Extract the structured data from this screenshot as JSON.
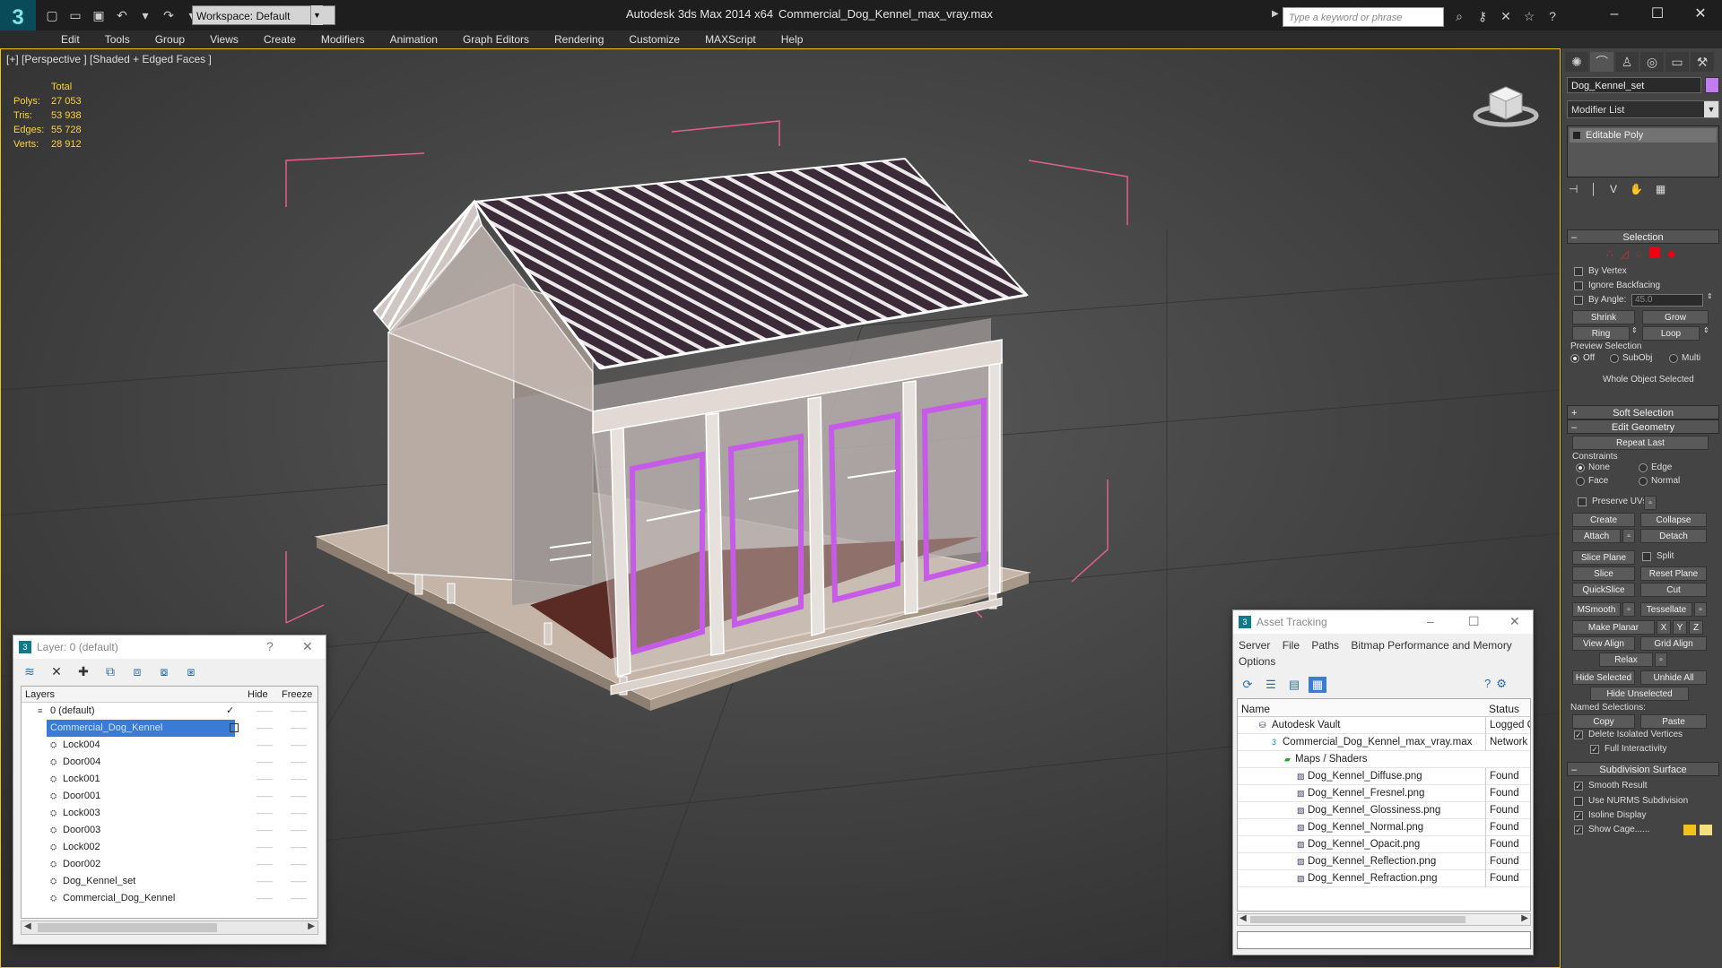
{
  "app": {
    "title": "Autodesk 3ds Max  2014 x64",
    "file": "Commercial_Dog_Kennel_max_vray.max",
    "workspace": "Workspace: Default",
    "search_placeholder": "Type a keyword or phrase"
  },
  "menu": [
    "Edit",
    "Tools",
    "Group",
    "Views",
    "Create",
    "Modifiers",
    "Animation",
    "Graph Editors",
    "Rendering",
    "Customize",
    "MAXScript",
    "Help"
  ],
  "viewport": {
    "label": "[+] [Perspective ] [Shaded + Edged Faces ]",
    "stats_header": "Total",
    "stats": [
      {
        "k": "Polys:",
        "v": "27 053"
      },
      {
        "k": "Tris:",
        "v": "53 938"
      },
      {
        "k": "Edges:",
        "v": "55 728"
      },
      {
        "k": "Verts:",
        "v": "28 912"
      }
    ]
  },
  "command_panel": {
    "object_name": "Dog_Kennel_set",
    "object_color": "#c37cf0",
    "modifier_list": "Modifier List",
    "stack_item": "Editable Poly",
    "selection": {
      "title": "Selection",
      "by_vertex": "By Vertex",
      "ignore_backfacing": "Ignore Backfacing",
      "by_angle": "By Angle:",
      "angle_value": "45.0",
      "shrink": "Shrink",
      "grow": "Grow",
      "ring": "Ring",
      "loop": "Loop",
      "preview_selection": "Preview Selection",
      "off": "Off",
      "subobj": "SubObj",
      "multi": "Multi",
      "whole_object": "Whole Object Selected"
    },
    "soft_selection": "Soft Selection",
    "edit_geometry": {
      "title": "Edit Geometry",
      "repeat_last": "Repeat Last",
      "constraints": "Constraints",
      "none": "None",
      "edge": "Edge",
      "face": "Face",
      "normal": "Normal",
      "preserve_uvs": "Preserve UVs",
      "create": "Create",
      "collapse": "Collapse",
      "attach": "Attach",
      "detach": "Detach",
      "slice_plane": "Slice Plane",
      "split": "Split",
      "slice": "Slice",
      "reset_plane": "Reset Plane",
      "quickslice": "QuickSlice",
      "cut": "Cut",
      "msmooth": "MSmooth",
      "tessellate": "Tessellate",
      "make_planar": "Make Planar",
      "x": "X",
      "y": "Y",
      "z": "Z",
      "view_align": "View Align",
      "grid_align": "Grid Align",
      "relax": "Relax",
      "hide_selected": "Hide Selected",
      "unhide_all": "Unhide All",
      "hide_unselected": "Hide Unselected",
      "named_selections": "Named Selections:",
      "copy": "Copy",
      "paste": "Paste",
      "delete_isolated": "Delete Isolated Vertices",
      "full_interactivity": "Full Interactivity"
    },
    "subdivision": {
      "title": "Subdivision Surface",
      "smooth_result": "Smooth Result",
      "use_nurms": "Use NURMS Subdivision",
      "isoline": "Isoline Display",
      "show_cage": "Show Cage......",
      "cage_color1": "#f2c21a",
      "cage_color2": "#f4e07a"
    }
  },
  "layer_explorer": {
    "title": "Layer: 0 (default)",
    "help": "?",
    "columns": {
      "name": "Layers",
      "hide": "Hide",
      "freeze": "Freeze"
    },
    "rows": [
      {
        "name": "0 (default)",
        "level": 0,
        "type": "layer",
        "checked": true
      },
      {
        "name": "Commercial_Dog_Kennel",
        "level": 0,
        "type": "layer",
        "selected": true
      },
      {
        "name": "Lock004",
        "level": 1
      },
      {
        "name": "Door004",
        "level": 1
      },
      {
        "name": "Lock001",
        "level": 1
      },
      {
        "name": "Door001",
        "level": 1
      },
      {
        "name": "Lock003",
        "level": 1
      },
      {
        "name": "Door003",
        "level": 1
      },
      {
        "name": "Lock002",
        "level": 1
      },
      {
        "name": "Door002",
        "level": 1
      },
      {
        "name": "Dog_Kennel_set",
        "level": 1
      },
      {
        "name": "Commercial_Dog_Kennel",
        "level": 1
      }
    ]
  },
  "asset_tracking": {
    "title": "Asset Tracking",
    "menu": [
      "Server",
      "File",
      "Paths",
      "Bitmap Performance and Memory",
      "Options"
    ],
    "columns": {
      "name": "Name",
      "status": "Status"
    },
    "rows": [
      {
        "name": "Autodesk Vault",
        "level": 1,
        "status": "Logged C"
      },
      {
        "name": "Commercial_Dog_Kennel_max_vray.max",
        "level": 2,
        "status": "Network"
      },
      {
        "name": "Maps / Shaders",
        "level": 3,
        "status": ""
      },
      {
        "name": "Dog_Kennel_Diffuse.png",
        "level": 4,
        "status": "Found"
      },
      {
        "name": "Dog_Kennel_Fresnel.png",
        "level": 4,
        "status": "Found"
      },
      {
        "name": "Dog_Kennel_Glossiness.png",
        "level": 4,
        "status": "Found"
      },
      {
        "name": "Dog_Kennel_Normal.png",
        "level": 4,
        "status": "Found"
      },
      {
        "name": "Dog_Kennel_Opacit.png",
        "level": 4,
        "status": "Found"
      },
      {
        "name": "Dog_Kennel_Reflection.png",
        "level": 4,
        "status": "Found"
      },
      {
        "name": "Dog_Kennel_Refraction.png",
        "level": 4,
        "status": "Found"
      }
    ]
  }
}
